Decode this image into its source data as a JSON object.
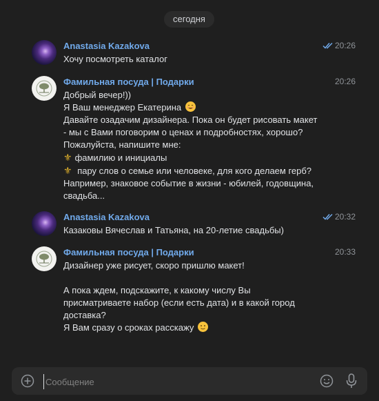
{
  "date_divider": "сегодня",
  "messages": [
    {
      "author": "Anastasia Kazakova",
      "time": "20:26",
      "read": true,
      "lines": [
        "Хочу посмотреть каталог"
      ]
    },
    {
      "author": "Фамильная посуда | Подарки",
      "time": "20:26",
      "read": false,
      "line1": "Добрый вечер!))",
      "line2": "Я Ваш менеджер Екатерина",
      "line3": "Давайте озадачим дизайнера. Пока он будет рисовать макет",
      "line4": "- мы с Вами поговорим о ценах и подробностях, хорошо?",
      "line5": "Пожалуйста, напишите мне:",
      "line6": "фамилию и инициалы",
      "line7": "пару слов о семье или человеке, для кого делаем герб?",
      "line8": "Например, знаковое событие в жизни - юбилей, годовщина,",
      "line9": "свадьба..."
    },
    {
      "author": "Anastasia Kazakova",
      "time": "20:32",
      "read": true,
      "lines": [
        "Казаковы Вячеслав и Татьяна, на 20-летие свадьбы)"
      ]
    },
    {
      "author": "Фамильная посуда | Подарки",
      "time": "20:33",
      "read": false,
      "line1": "Дизайнер уже рисует, скоро пришлю макет!",
      "line2": "А пока ждем, подскажите, к какому числу Вы",
      "line3": "присматриваете набор (если есть дата) и в какой город",
      "line4": "доставка?",
      "line5": "Я Вам сразу о сроках расскажу"
    }
  ],
  "composer": {
    "placeholder": "Сообщение"
  },
  "icons": {
    "attach": "plus-circle-icon",
    "emoji": "smile-icon",
    "voice": "microphone-icon",
    "read": "double-check-icon",
    "fleur": "fleur-de-lis-icon"
  },
  "colors": {
    "background": "#1f1f1f",
    "author": "#71aaeb",
    "text": "#e1e3e6",
    "muted": "#909499",
    "composer": "#2b2b2b"
  }
}
